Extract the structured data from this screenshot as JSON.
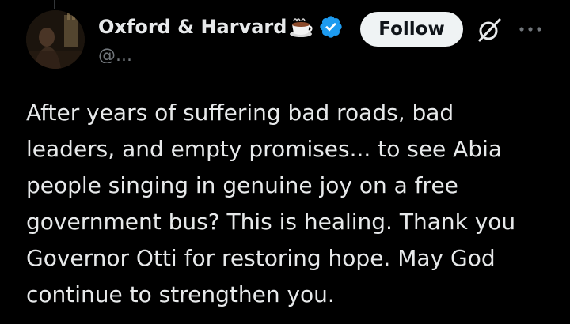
{
  "post": {
    "author": {
      "display_name": "Oxford & Harvard",
      "name_emoji": "coffee-cup-icon",
      "verified": true,
      "handle": "@..."
    },
    "follow_label": "Follow",
    "text_lines": [
      "After years of suffering bad roads, bad",
      "leaders, and empty promises... to see Abia",
      "people singing in genuine joy on a free",
      "government bus? This is healing. Thank you",
      "Governor Otti for restoring hope. May God",
      "continue to strengthen you."
    ]
  },
  "icons": {
    "grok": "grok-icon",
    "more": "more-options-icon",
    "verified": "verified-badge-icon"
  },
  "colors": {
    "background": "#000000",
    "text": "#e7e9ea",
    "muted": "#71767b",
    "verified_blue": "#1d9bf0",
    "follow_bg": "#eff3f4",
    "follow_text": "#0f1419"
  }
}
